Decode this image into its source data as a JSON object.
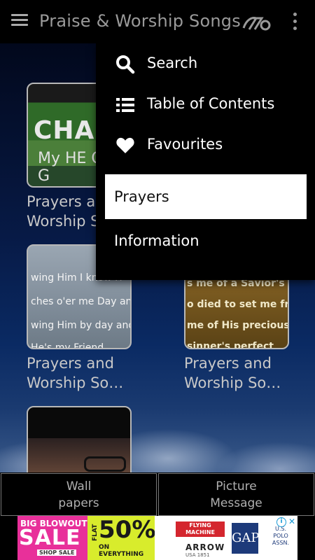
{
  "appbar": {
    "title": "Praise & Worship Songs",
    "menu_icon": "hamburger-menu-icon",
    "logo_icon": "app-logo-icon",
    "overflow_icon": "more-vertical-icon"
  },
  "menu": {
    "items": [
      {
        "label": "Search",
        "icon": "search-icon"
      },
      {
        "label": "Table of Contents",
        "icon": "list-icon"
      },
      {
        "label": "Favourites",
        "icon": "heart-icon"
      }
    ],
    "selected_label": "Prayers",
    "info_label": "Information"
  },
  "cards": [
    {
      "label": "Prayers a\nWorship S",
      "thumb_text": [
        "CHAN",
        "My HE  OH G"
      ]
    },
    {
      "label": "Prayers and\nWorship So…",
      "thumb_text": [
        "wing Him I know H",
        "ches o'er me Day an",
        "wing Him by day and",
        "He's my Friend"
      ]
    },
    {
      "label": "Prayers and\nWorship So…",
      "thumb_text": [
        "s me of a Savior's",
        "o died to set me fr",
        "me of His precious",
        "sinner's perfect"
      ]
    },
    {
      "label": "",
      "thumb_text": []
    }
  ],
  "bottom": {
    "wallpapers": "Wall\npapers",
    "picture_message": "Picture\nMessage"
  },
  "ad": {
    "sale_top": "BIG BLOWOUT",
    "sale_big": "SALE",
    "sale_cta": "SHOP SALE",
    "flat": "FLAT",
    "percent": "50%",
    "on_everything": "ON EVERYTHING",
    "flying_machine": "FLYING MACHINE",
    "arrow": "ARROW",
    "arrow_sub": "USA 1851",
    "gap": "GAP",
    "polo": "U.S. POLO ASSN.",
    "adchoices": "i",
    "close": "✕"
  },
  "colors": {
    "selected_bg": "#ffffff",
    "ad_pink": "#e8309a",
    "ad_lime": "#d8ec2c"
  }
}
